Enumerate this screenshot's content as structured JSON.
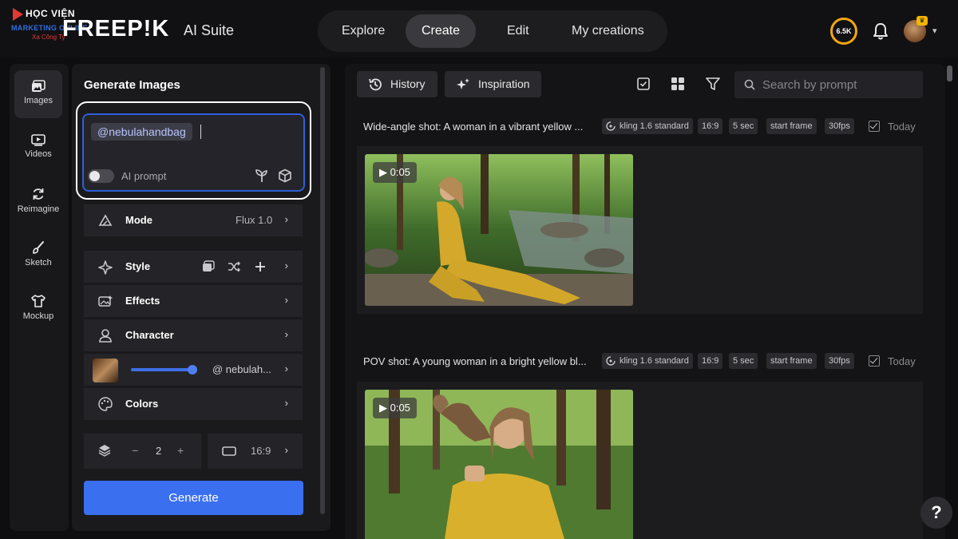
{
  "watermark": {
    "top": "HỌC VIỆN",
    "middle": "MARKETING ONLINE",
    "bottom": "Xa Công Ty"
  },
  "brand": {
    "logo": "FREEP!K",
    "suite": "AI Suite"
  },
  "nav": {
    "tabs": [
      {
        "label": "Explore"
      },
      {
        "label": "Create"
      },
      {
        "label": "Edit"
      },
      {
        "label": "My creations"
      }
    ],
    "active": "Create"
  },
  "header": {
    "credits": "6.5K",
    "icons": [
      "bell-icon",
      "avatar",
      "chevron-down-icon"
    ]
  },
  "rail": {
    "items": [
      {
        "label": "Images",
        "icon": "image-icon"
      },
      {
        "label": "Videos",
        "icon": "video-icon"
      },
      {
        "label": "Reimagine",
        "icon": "refresh-icon"
      },
      {
        "label": "Sketch",
        "icon": "brush-icon"
      },
      {
        "label": "Mockup",
        "icon": "tshirt-icon"
      }
    ]
  },
  "panel": {
    "title": "Generate Images",
    "prompt": {
      "mention": "@nebulahandbag",
      "ai_prompt_label": "AI prompt"
    },
    "mode": {
      "label": "Mode",
      "value": "Flux 1.0"
    },
    "style": {
      "label": "Style"
    },
    "effects": {
      "label": "Effects"
    },
    "character": {
      "label": "Character",
      "ref_label": "@ nebulah...",
      "strength_percent": 100
    },
    "colors": {
      "label": "Colors"
    },
    "count": {
      "minus": "−",
      "value": "2",
      "plus": "+"
    },
    "aspect": {
      "value": "16:9"
    },
    "generate_label": "Generate"
  },
  "toolbar": {
    "history_label": "History",
    "inspiration_label": "Inspiration",
    "search_placeholder": "Search by prompt"
  },
  "entries": [
    {
      "prompt": "Wide-angle shot: A woman in a vibrant yellow ...",
      "tags": [
        "kling 1.6 standard",
        "16:9",
        "5 sec",
        "start frame",
        "30fps"
      ],
      "date": "Today",
      "duration": "0:05"
    },
    {
      "prompt": "POV shot: A young woman in a bright yellow bl...",
      "tags": [
        "kling 1.6 standard",
        "16:9",
        "5 sec",
        "start frame",
        "30fps"
      ],
      "date": "Today",
      "duration": "0:05"
    }
  ],
  "help_label": "?"
}
